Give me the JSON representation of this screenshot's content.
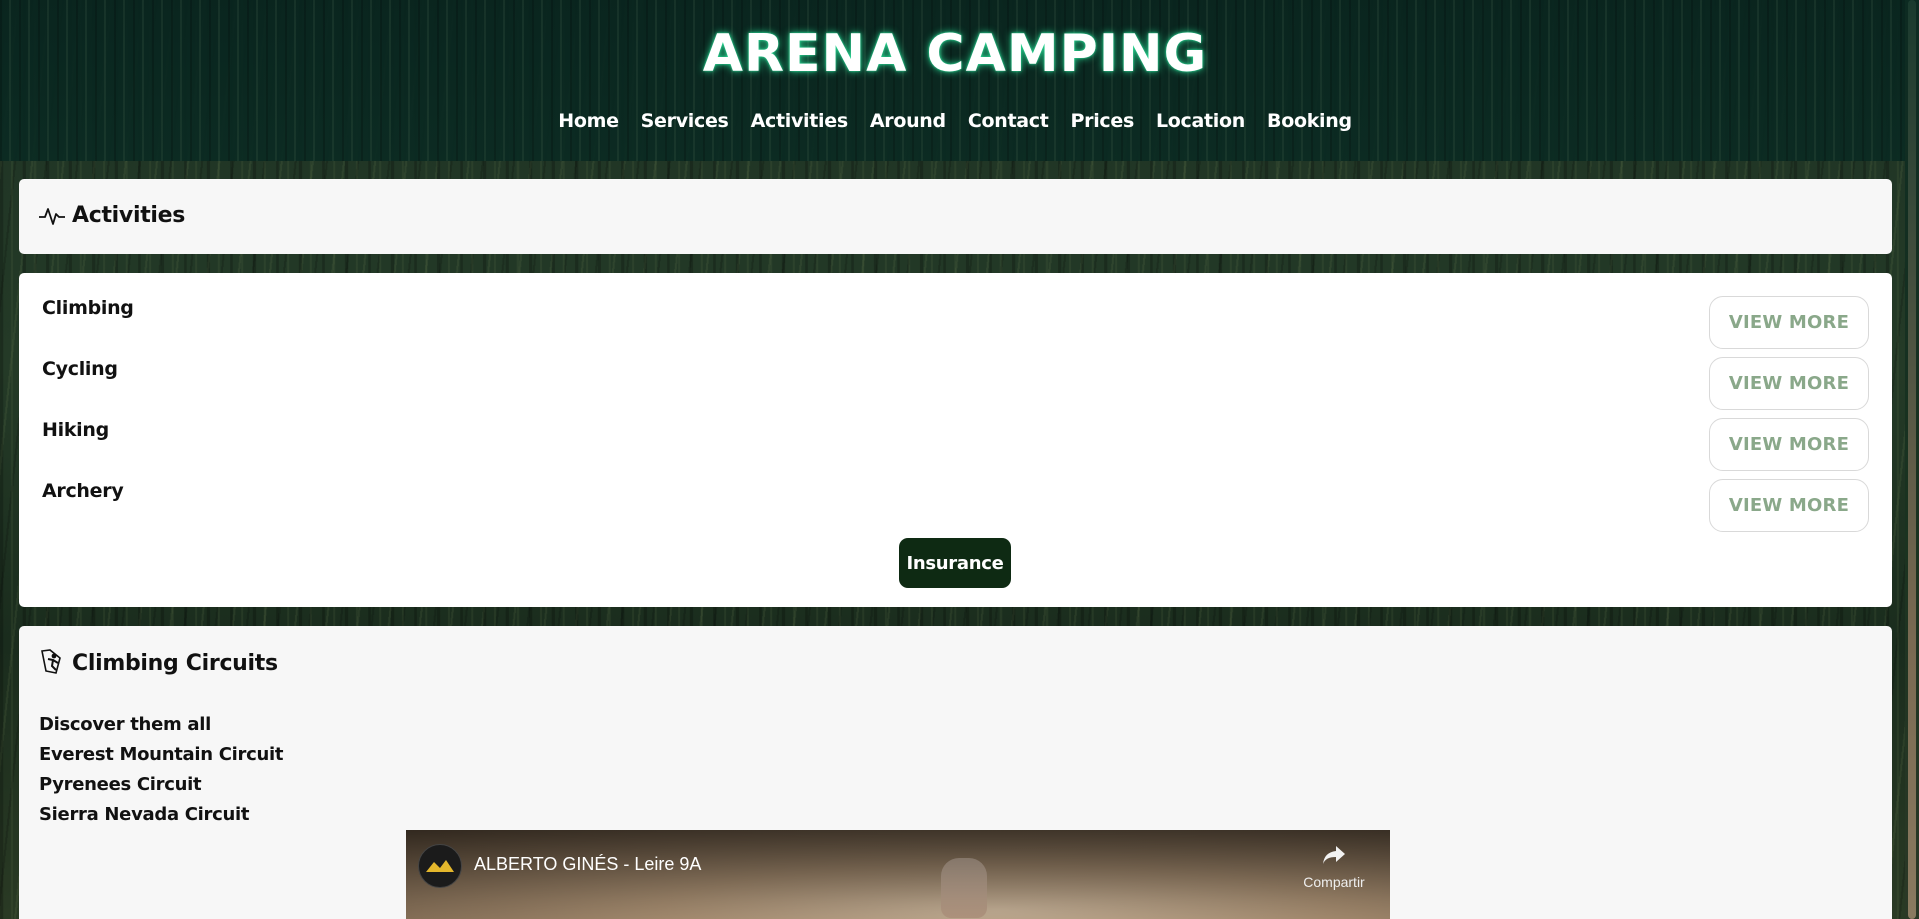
{
  "site": {
    "title": "ARENA CAMPING"
  },
  "nav": [
    {
      "label": "Home"
    },
    {
      "label": "Services"
    },
    {
      "label": "Activities"
    },
    {
      "label": "Around"
    },
    {
      "label": "Contact"
    },
    {
      "label": "Prices"
    },
    {
      "label": "Location"
    },
    {
      "label": "Booking"
    }
  ],
  "activities_section": {
    "title": "Activities",
    "icon": "pulse-icon",
    "items": [
      {
        "label": "Climbing",
        "button": "VIEW MORE"
      },
      {
        "label": "Cycling",
        "button": "VIEW MORE"
      },
      {
        "label": "Hiking",
        "button": "VIEW MORE"
      },
      {
        "label": "Archery",
        "button": "VIEW MORE"
      }
    ],
    "insurance_label": "Insurance"
  },
  "circuits_section": {
    "title": "Climbing Circuits",
    "icon": "climber-icon",
    "links": [
      {
        "label": "Discover them all"
      },
      {
        "label": "Everest Mountain Circuit"
      },
      {
        "label": "Pyrenees Circuit"
      },
      {
        "label": "Sierra Nevada Circuit"
      }
    ],
    "video": {
      "title": "ALBERTO GINÉS - Leire 9A",
      "share_label": "Compartir"
    }
  },
  "colors": {
    "header_bg": "#0a2a22",
    "title_glow": "#28dc96",
    "button_text": "#8aa88a",
    "insurance_bg": "#0e2a13",
    "card_bg": "#f7f7f7"
  }
}
